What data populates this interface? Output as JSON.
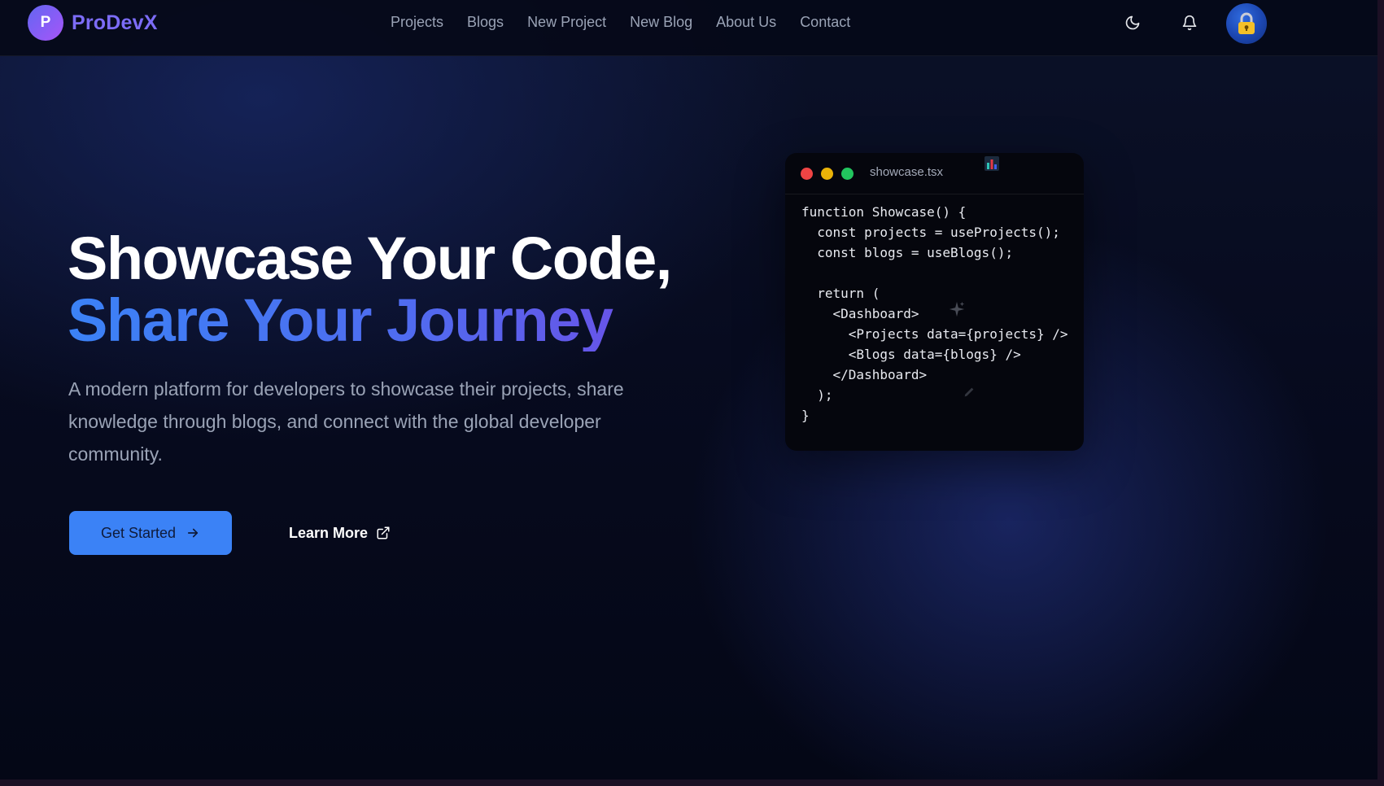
{
  "navbar": {
    "logo_letter": "P",
    "brand_name": "ProDevX",
    "links": [
      {
        "label": "Projects"
      },
      {
        "label": "Blogs"
      },
      {
        "label": "New Project"
      },
      {
        "label": "New Blog"
      },
      {
        "label": "About Us"
      },
      {
        "label": "Contact"
      }
    ],
    "icons": {
      "theme_toggle": "moon-icon",
      "notifications": "bell-icon",
      "avatar": "lock-icon"
    }
  },
  "hero": {
    "title_line1": "Showcase Your Code,",
    "title_line2": "Share Your Journey",
    "description": "A modern platform for developers to showcase their projects, share knowledge through blogs, and connect with the global developer community.",
    "primary_button": "Get Started",
    "secondary_button": "Learn More"
  },
  "code_window": {
    "filename": "showcase.tsx",
    "code": "function Showcase() {\n  const projects = useProjects();\n  const blogs = useBlogs();\n\n  return (\n    <Dashboard>\n      <Projects data={projects} />\n      <Blogs data={blogs} />\n    </Dashboard>\n  );\n}"
  },
  "colors": {
    "accent": "#3b82f6",
    "brand": "#7c6cf7",
    "gradient_end": "#6d4fe6",
    "window_dot_red": "#ef4444",
    "window_dot_yellow": "#eab308",
    "window_dot_green": "#22c55e"
  }
}
